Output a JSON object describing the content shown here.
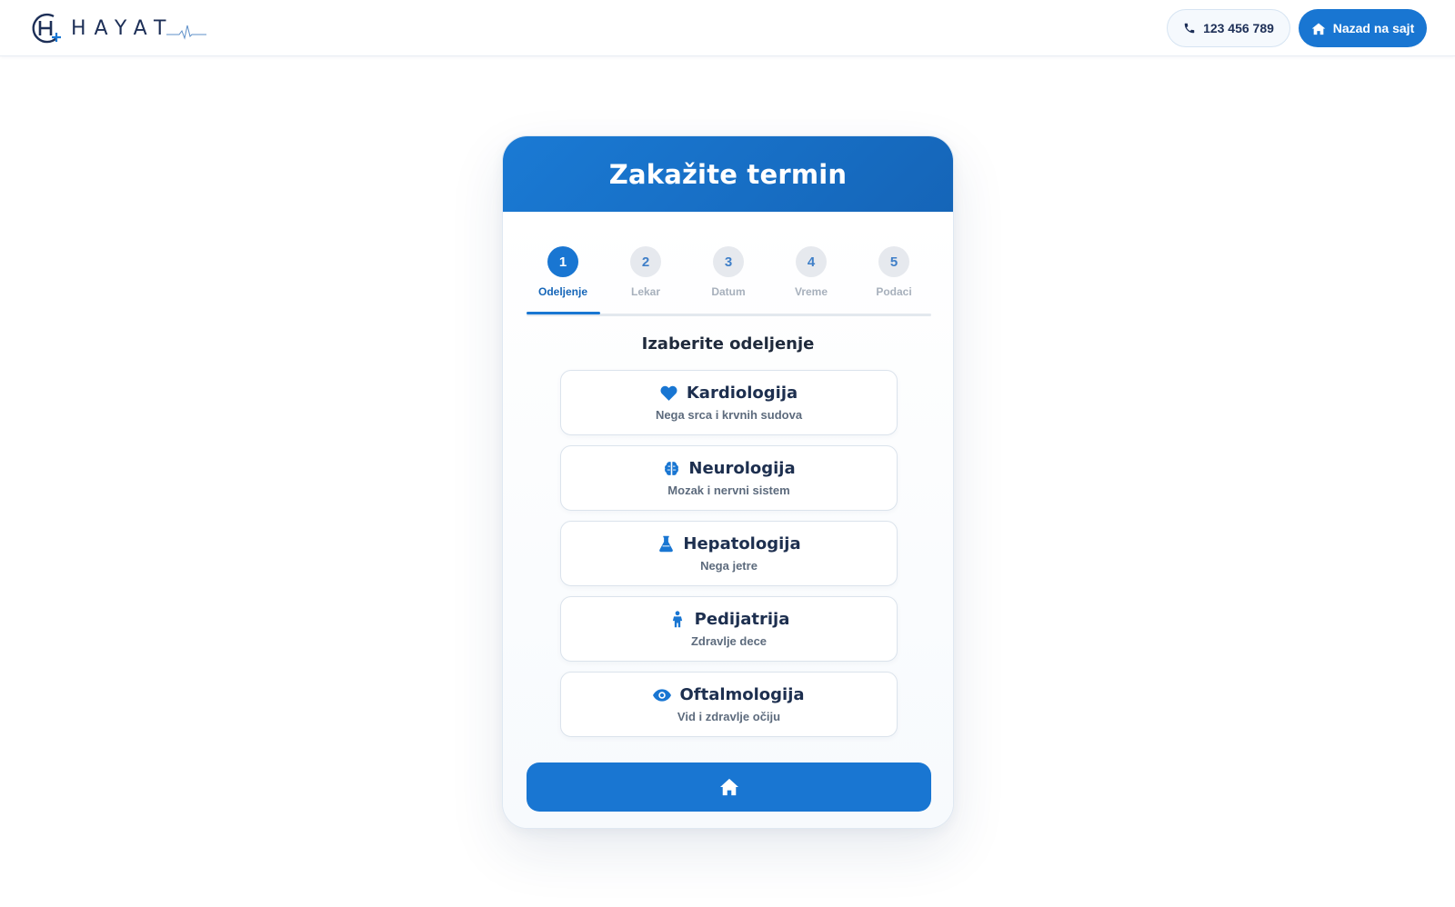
{
  "brand": {
    "name": "HAYAT",
    "accent": "#1976d2",
    "navy": "#1d2f57"
  },
  "header": {
    "phone": {
      "icon": "phone-icon",
      "label": "123 456 789"
    },
    "back": {
      "icon": "home-icon",
      "label": "Nazad na sajt"
    }
  },
  "card": {
    "title": "Zakažite termin",
    "steps": [
      {
        "number": "1",
        "label": "Odeljenje",
        "active": true
      },
      {
        "number": "2",
        "label": "Lekar",
        "active": false
      },
      {
        "number": "3",
        "label": "Datum",
        "active": false
      },
      {
        "number": "4",
        "label": "Vreme",
        "active": false
      },
      {
        "number": "5",
        "label": "Podaci",
        "active": false
      }
    ],
    "section_title": "Izaberite odeljenje",
    "departments": [
      {
        "icon": "heart-icon",
        "name": "Kardiologija",
        "desc": "Nega srca i krvnih sudova"
      },
      {
        "icon": "brain-icon",
        "name": "Neurologija",
        "desc": "Mozak i nervni sistem"
      },
      {
        "icon": "flask-icon",
        "name": "Hepatologija",
        "desc": "Nega jetre"
      },
      {
        "icon": "child-icon",
        "name": "Pedijatrija",
        "desc": "Zdravlje dece"
      },
      {
        "icon": "eye-icon",
        "name": "Oftalmologija",
        "desc": "Vid i zdravlje očiju"
      }
    ],
    "home_button_icon": "home-icon"
  }
}
